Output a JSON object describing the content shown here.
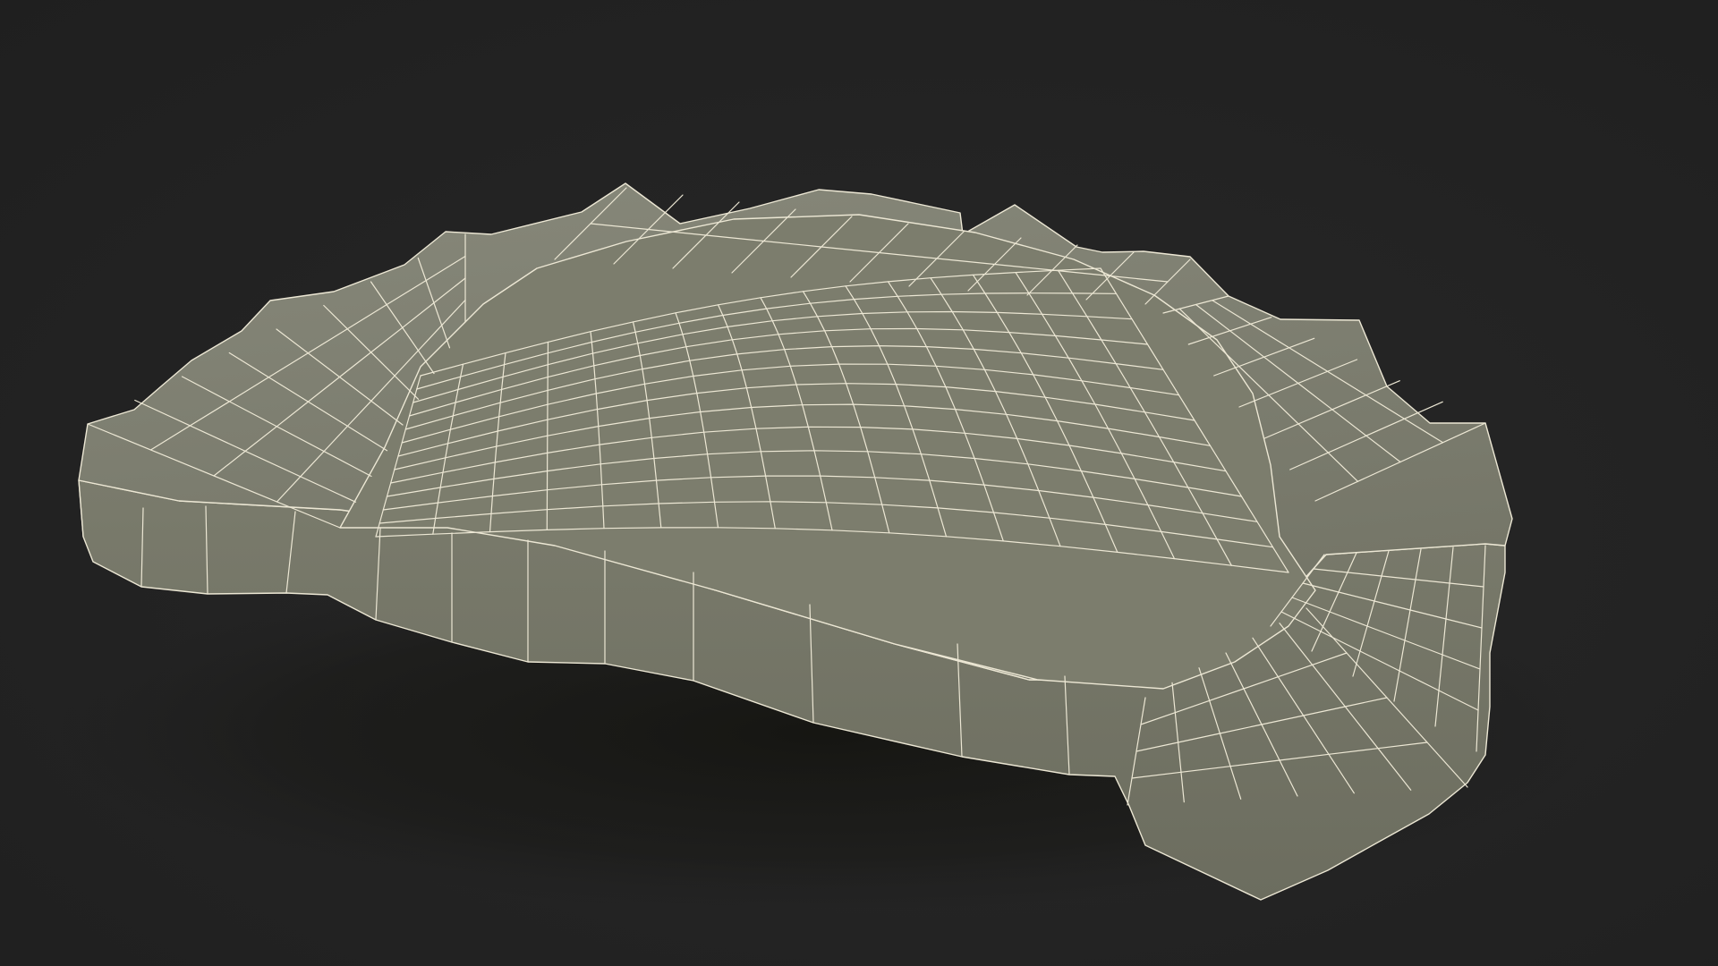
{
  "viewport": {
    "background_color": "#232323",
    "shadow_color": "#161612"
  },
  "model": {
    "icon": "wireframe-mesh-object",
    "fill_color": "#7b7c6b",
    "wire_color": "#ece7d4",
    "lit_fill_color": "#8a8b79",
    "shade_fill_color": "#6e6f60"
  }
}
